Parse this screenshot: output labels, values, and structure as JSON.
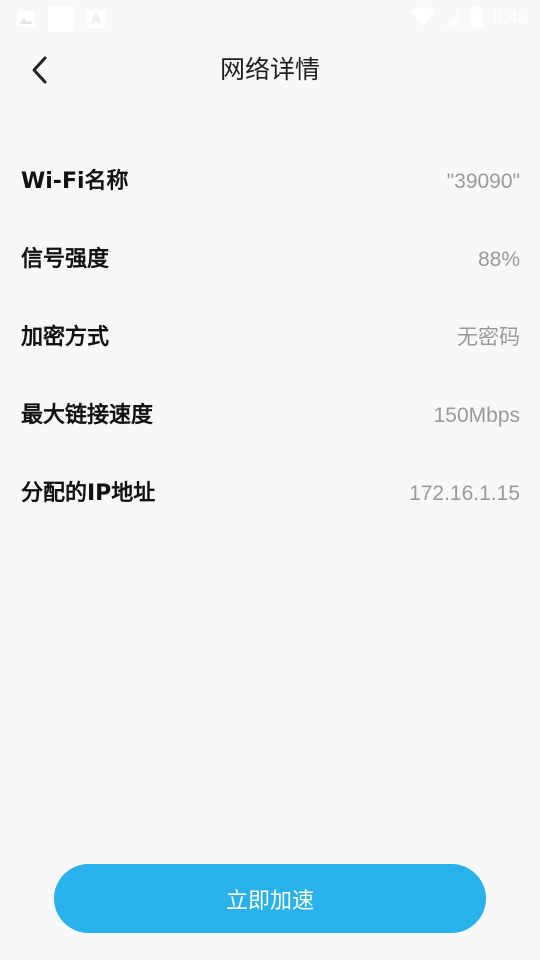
{
  "status_bar": {
    "time": "8:48",
    "icons": [
      "image-icon",
      "notification-square-icon",
      "app-a-icon",
      "wifi-icon",
      "signal-icon",
      "battery-icon"
    ]
  },
  "header": {
    "title": "网络详情",
    "back_icon": "chevron-left-icon"
  },
  "details": [
    {
      "label": "Wi-Fi名称",
      "value": "\"39090\""
    },
    {
      "label": "信号强度",
      "value": "88%"
    },
    {
      "label": "加密方式",
      "value": "无密码"
    },
    {
      "label": "最大链接速度",
      "value": "150Mbps"
    },
    {
      "label": "分配的IP地址",
      "value": "172.16.1.15"
    }
  ],
  "action": {
    "accelerate_label": "立即加速"
  },
  "colors": {
    "background": "#f8f8f8",
    "accent": "#28b1eb",
    "label": "#111111",
    "value": "#9a9a9a"
  }
}
